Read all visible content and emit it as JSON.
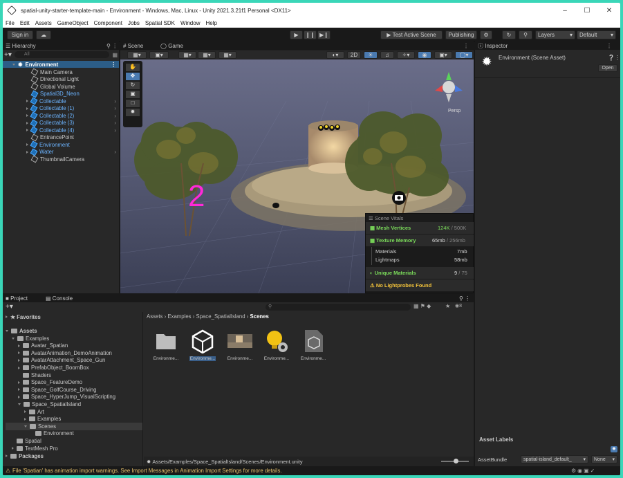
{
  "window": {
    "title": "spatial-unity-starter-template-main - Environment - Windows, Mac, Linux - Unity 2021.3.21f1 Personal <DX11>"
  },
  "menu": [
    "File",
    "Edit",
    "Assets",
    "GameObject",
    "Component",
    "Jobs",
    "Spatial SDK",
    "Window",
    "Help"
  ],
  "toolbar": {
    "sign_in": "Sign in",
    "test_active_scene": "Test Active Scene",
    "publishing": "Publishing",
    "layers": "Layers",
    "layout": "Default"
  },
  "hierarchy": {
    "tab": "Hierarchy",
    "search": "All",
    "root": "Environment",
    "items": [
      {
        "label": "Main Camera",
        "style": "normal",
        "arrow": false,
        "child": false
      },
      {
        "label": "Directional Light",
        "style": "normal",
        "arrow": false,
        "child": false
      },
      {
        "label": "Global Volume",
        "style": "normal",
        "arrow": false,
        "child": false
      },
      {
        "label": "Spatial3D_Neon",
        "style": "blue",
        "arrow": false,
        "child": false
      },
      {
        "label": "Collectable",
        "style": "blue",
        "arrow": true,
        "child": true
      },
      {
        "label": "Collectable (1)",
        "style": "blue",
        "arrow": true,
        "child": true
      },
      {
        "label": "Collectable (2)",
        "style": "blue",
        "arrow": true,
        "child": true
      },
      {
        "label": "Collectable (3)",
        "style": "blue",
        "arrow": true,
        "child": true
      },
      {
        "label": "Collectable (4)",
        "style": "blue",
        "arrow": true,
        "child": true
      },
      {
        "label": "EntrancePoint",
        "style": "normal",
        "arrow": false,
        "child": false
      },
      {
        "label": "Environment",
        "style": "blue",
        "arrow": true,
        "child": false
      },
      {
        "label": "Water",
        "style": "blue",
        "arrow": true,
        "child": true
      },
      {
        "label": "ThumbnailCamera",
        "style": "normal",
        "arrow": false,
        "child": false
      }
    ]
  },
  "scene_view": {
    "tab_scene": "Scene",
    "tab_game": "Game",
    "mode_2d": "2D",
    "overlay_number": "2",
    "persp": "Persp"
  },
  "scene_vitals": {
    "title": "Scene Vitals",
    "mesh_vertices": {
      "label": "Mesh Vertices",
      "value": "124K",
      "limit": "500K"
    },
    "texture_memory": {
      "label": "Texture Memory",
      "value": "65mb",
      "limit": "256mb"
    },
    "materials": {
      "label": "Materials",
      "value": "7mb"
    },
    "lightmaps": {
      "label": "Lightmaps",
      "value": "58mb"
    },
    "unique_materials": {
      "label": "Unique Materials",
      "value": "9",
      "limit": "75"
    },
    "warning": "No Lightprobes Found"
  },
  "inspector": {
    "tab": "Inspector",
    "title": "Environment (Scene Asset)",
    "open": "Open",
    "asset_labels": "Asset Labels",
    "asset_bundle_label": "AssetBundle",
    "asset_bundle_value": "spatial-island_default_",
    "variant": "None"
  },
  "project": {
    "tab_project": "Project",
    "tab_console": "Console",
    "favorites": "Favorites",
    "assets_root": "Assets",
    "badge": "8",
    "tree": [
      {
        "label": "Examples",
        "depth": 1,
        "arrow": "open"
      },
      {
        "label": "Avatar_Spatian",
        "depth": 2,
        "arrow": "closed"
      },
      {
        "label": "AvatarAnimation_DemoAnimation",
        "depth": 2,
        "arrow": "closed"
      },
      {
        "label": "AvatarAttachment_Space_Gun",
        "depth": 2,
        "arrow": "closed"
      },
      {
        "label": "PrefabObject_BoomBox",
        "depth": 2,
        "arrow": "closed"
      },
      {
        "label": "Shaders",
        "depth": 2,
        "arrow": "none"
      },
      {
        "label": "Space_FeatureDemo",
        "depth": 2,
        "arrow": "closed"
      },
      {
        "label": "Space_GolfCourse_Driving",
        "depth": 2,
        "arrow": "closed"
      },
      {
        "label": "Space_HyperJump_VisualScripting",
        "depth": 2,
        "arrow": "closed"
      },
      {
        "label": "Space_SpatialIsland",
        "depth": 2,
        "arrow": "open"
      },
      {
        "label": "Art",
        "depth": 3,
        "arrow": "closed"
      },
      {
        "label": "Examples",
        "depth": 3,
        "arrow": "closed"
      },
      {
        "label": "Scenes",
        "depth": 3,
        "arrow": "open"
      },
      {
        "label": "Environment",
        "depth": 4,
        "arrow": "none"
      },
      {
        "label": "Spatial",
        "depth": 1,
        "arrow": "none"
      },
      {
        "label": "TextMesh Pro",
        "depth": 1,
        "arrow": "closed"
      }
    ],
    "packages": "Packages",
    "breadcrumb": [
      "Assets",
      "Examples",
      "Space_SpatialIsland",
      "Scenes"
    ],
    "assets": [
      "Environme...",
      "Environme...",
      "Environme...",
      "Environme...",
      "Environme..."
    ],
    "path": "Assets/Examples/Space_SpatialIsland/Scenes/Environment.unity"
  },
  "status": {
    "message": "File 'Spatian' has animation import warnings. See Import Messages in Animation Import Settings for more details."
  },
  "colors": {
    "accent": "#3ad6b8",
    "selection": "#2c5d87",
    "link": "#6cb4ff",
    "vitals_green": "#7bdc5a",
    "warning": "#f2c23a"
  }
}
